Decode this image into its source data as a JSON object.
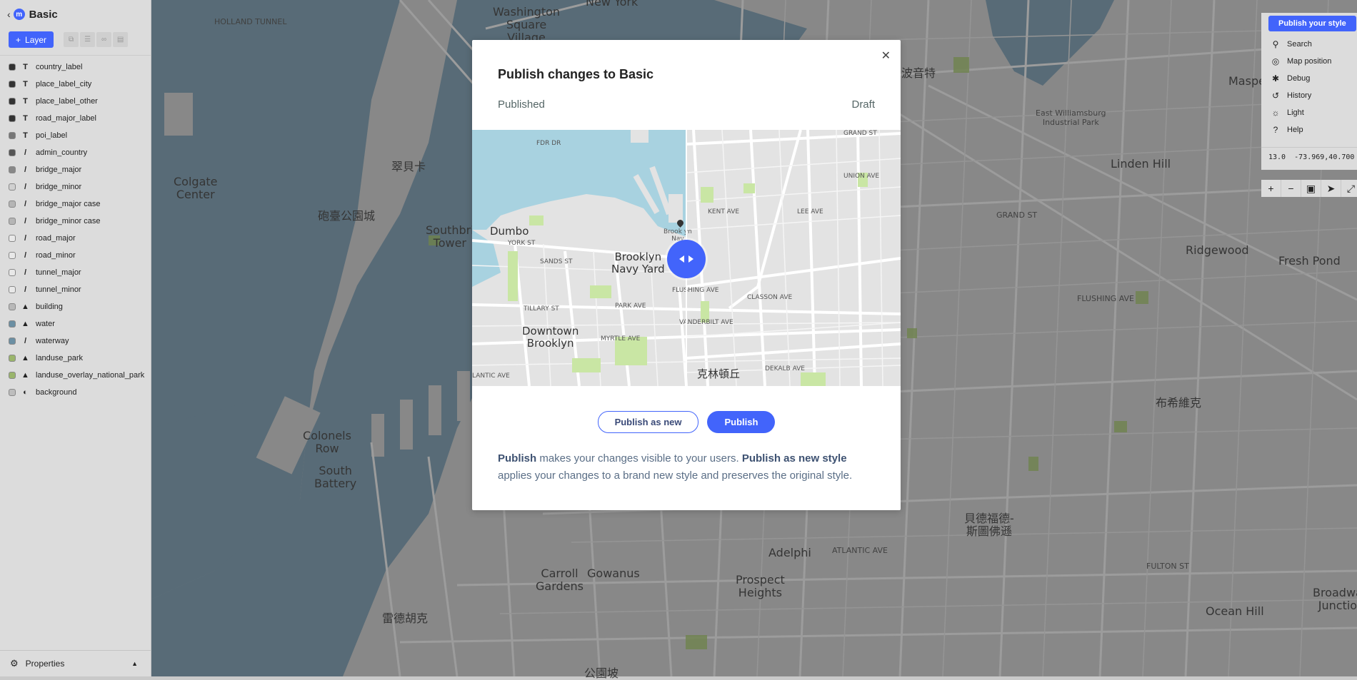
{
  "map": {
    "labels": [
      {
        "text": "Washington\nSquare\nVillage",
        "big": true
      },
      {
        "text": "New York",
        "big": true
      },
      {
        "text": "Colgate\nCenter",
        "big": true
      },
      {
        "text": "翠貝卡",
        "big": true
      },
      {
        "text": "砲臺公園城",
        "big": true
      },
      {
        "text": "Southbri\nTower",
        "big": true
      },
      {
        "text": "Colonels\nRow",
        "big": true
      },
      {
        "text": "South\nBattery",
        "big": true
      },
      {
        "text": "Carroll\nGardens",
        "big": true
      },
      {
        "text": "Gowanus",
        "big": true
      },
      {
        "text": "雷德胡克",
        "big": true
      },
      {
        "text": "Prospect\nHeights",
        "big": true
      },
      {
        "text": "Adelphi",
        "big": true
      },
      {
        "text": "貝德福德-\n斯圖佛遜",
        "big": true
      },
      {
        "text": "布希維克",
        "big": true
      },
      {
        "text": "Ridgewood",
        "big": true
      },
      {
        "text": "Fresh Pond",
        "big": true
      },
      {
        "text": "Linden Hill",
        "big": true
      },
      {
        "text": "Maspeth",
        "big": true
      },
      {
        "text": "East Williamsburg\nIndustrial Park",
        "big": false
      },
      {
        "text": "波音特",
        "big": true
      },
      {
        "text": "Ocean Hill",
        "big": true
      },
      {
        "text": "Broadwa\nJunctio",
        "big": true
      },
      {
        "text": "公園坡",
        "big": true
      },
      {
        "text": "HOLLAND TUNNEL",
        "big": false
      },
      {
        "text": "GRAND ST",
        "big": false
      },
      {
        "text": "ATLANTIC AVE",
        "big": false
      },
      {
        "text": "FULTON ST",
        "big": false
      },
      {
        "text": "FLUSHING AVE",
        "big": false
      }
    ]
  },
  "sidebar": {
    "back_icon": "chevron-left-icon",
    "logo_icon": "mapbox-logo-icon",
    "title": "Basic",
    "add_layer_label": "Layer",
    "layers": [
      {
        "name": "country_label",
        "type": "T",
        "color": "#333333"
      },
      {
        "name": "place_label_city",
        "type": "T",
        "color": "#333333"
      },
      {
        "name": "place_label_other",
        "type": "T",
        "color": "#333333"
      },
      {
        "name": "road_major_label",
        "type": "T",
        "color": "#333333"
      },
      {
        "name": "poi_label",
        "type": "T",
        "color": "#777777"
      },
      {
        "name": "admin_country",
        "type": "line",
        "color": "#555555"
      },
      {
        "name": "bridge_major",
        "type": "line",
        "color": "#888888"
      },
      {
        "name": "bridge_minor",
        "type": "line",
        "color": "#d0d0d0"
      },
      {
        "name": "bridge_major case",
        "type": "line",
        "color": "#b5b5b5"
      },
      {
        "name": "bridge_minor case",
        "type": "line",
        "color": "#b5b5b5"
      },
      {
        "name": "road_major",
        "type": "line",
        "color": "#e8e8e8"
      },
      {
        "name": "road_minor",
        "type": "line",
        "color": "#e8e8e8"
      },
      {
        "name": "tunnel_major",
        "type": "line",
        "color": "#e8e8e8"
      },
      {
        "name": "tunnel_minor",
        "type": "line",
        "color": "#e8e8e8"
      },
      {
        "name": "building",
        "type": "fill",
        "color": "#b8b8b8"
      },
      {
        "name": "water",
        "type": "line-fill",
        "color": "#6b8fa3"
      },
      {
        "name": "waterway",
        "type": "line",
        "color": "#6b8fa3"
      },
      {
        "name": "landuse_park",
        "type": "fill",
        "color": "#9ab56b"
      },
      {
        "name": "landuse_overlay_national_park",
        "type": "fill",
        "color": "#9ab56b"
      },
      {
        "name": "background",
        "type": "bg",
        "color": "#bdbdbd"
      }
    ],
    "footer_label": "Properties"
  },
  "right_panel": {
    "publish_label": "Publish your style",
    "items": [
      {
        "label": "Search",
        "icon": "search-icon"
      },
      {
        "label": "Map position",
        "icon": "target-icon"
      },
      {
        "label": "Debug",
        "icon": "bug-icon"
      },
      {
        "label": "History",
        "icon": "history-icon"
      },
      {
        "label": "Light",
        "icon": "sun-icon"
      },
      {
        "label": "Help",
        "icon": "help-icon"
      }
    ],
    "zoom": "13.0",
    "coords": "-73.969,40.700"
  },
  "modal": {
    "title": "Publish changes to Basic",
    "published_label": "Published",
    "draft_label": "Draft",
    "compare_labels": [
      {
        "text": "Dumbo"
      },
      {
        "text": "Brooklyn\nNavy Yard"
      },
      {
        "text": "Downtown\nBrooklyn"
      },
      {
        "text": "克林頓丘"
      },
      {
        "text": "Brook yn\nNav"
      },
      {
        "text": "FDR DR"
      },
      {
        "text": "YORK ST"
      },
      {
        "text": "SANDS ST"
      },
      {
        "text": "FLUSHING AVE"
      },
      {
        "text": "PARK AVE"
      },
      {
        "text": "TILLARY ST"
      },
      {
        "text": "MYRTLE AVE"
      },
      {
        "text": "DEKALB AVE"
      },
      {
        "text": "GRAND ST"
      },
      {
        "text": "LANTIC AVE"
      },
      {
        "text": "KENT AVE"
      },
      {
        "text": "UNION AVE"
      },
      {
        "text": "LEE AVE"
      },
      {
        "text": "CLASSON AVE"
      },
      {
        "text": "VANDERBILT AVE"
      }
    ],
    "publish_new_label": "Publish as new",
    "publish_label": "Publish",
    "desc_b1": "Publish",
    "desc_t1": " makes your changes visible to your users. ",
    "desc_b2": "Publish as new style",
    "desc_t2": " applies your changes to a brand new style and preserves the original style."
  },
  "colors": {
    "accent": "#4264fb",
    "water_left": "#a8d2e0",
    "park": "#c9e6a4"
  }
}
